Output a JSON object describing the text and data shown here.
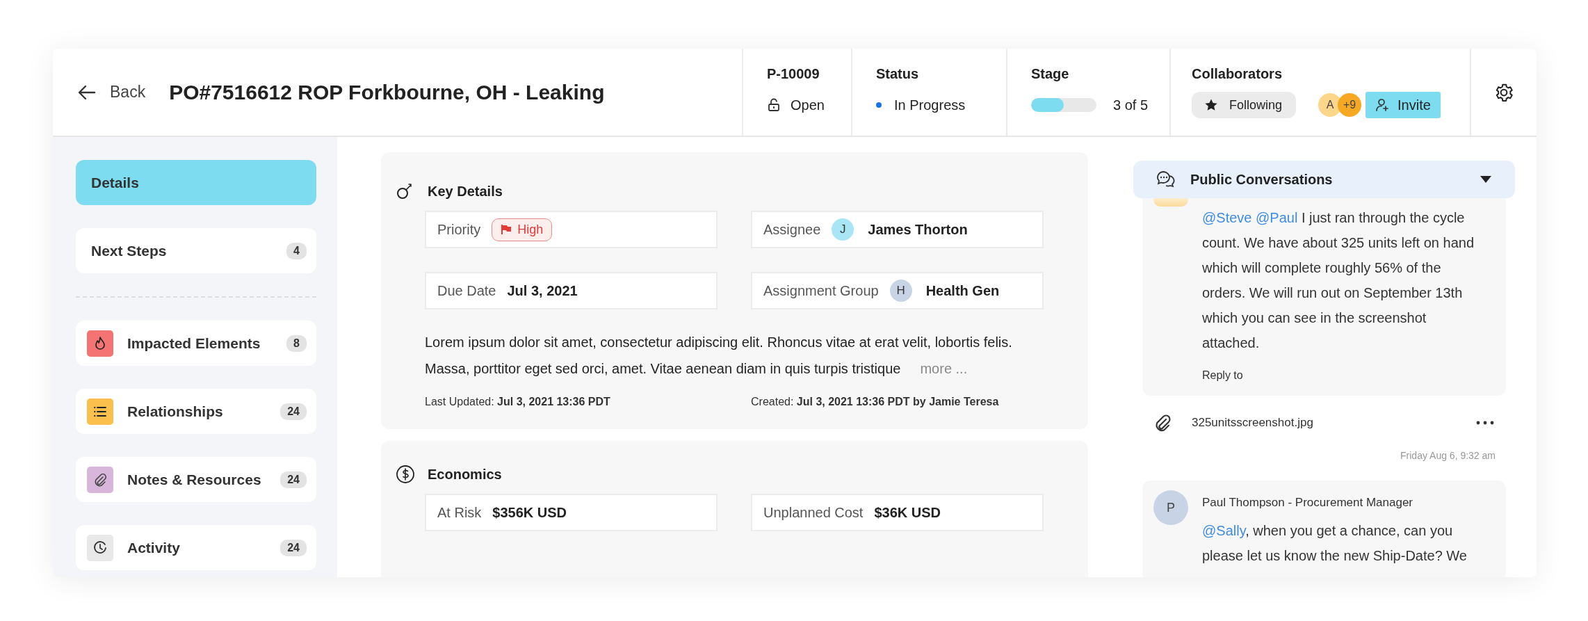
{
  "header": {
    "back": "Back",
    "title": "PO#7516612 ROP Forkbourne, OH - Leaking",
    "ticket": {
      "id": "P-10009",
      "state": "Open"
    },
    "status": {
      "label": "Status",
      "value": "In Progress"
    },
    "stage": {
      "label": "Stage",
      "level": 0.5,
      "reading": "3 of 5"
    },
    "collaborators": {
      "label": "Collaborators",
      "follow": "Following",
      "avatars": [
        {
          "text": "A",
          "color": "#fcd68a"
        },
        {
          "text": "+9",
          "color": "#f7a823"
        }
      ],
      "invite": "Invite"
    }
  },
  "sidebar": {
    "primary": [
      {
        "label": "Details",
        "selected": true
      },
      {
        "label": "Next Steps",
        "count": "4",
        "selected": false
      }
    ],
    "sections": [
      {
        "label": "Impacted Elements",
        "count": "8",
        "selected": false,
        "kind": "fire",
        "color": "#f47373"
      },
      {
        "label": "Relationships",
        "count": "24",
        "selected": false,
        "kind": "list",
        "color": "#fbbf4e"
      },
      {
        "label": "Notes & Resources",
        "count": "24",
        "selected": false,
        "kind": "clip",
        "color": "#d8b6dc"
      },
      {
        "label": "Activity",
        "count": "24",
        "selected": false,
        "kind": "clock",
        "color": "#e8e8e8"
      }
    ]
  },
  "key_details": {
    "title": "Key Details",
    "fields": [
      {
        "label": "Priority",
        "value": "High",
        "kind": "flag"
      },
      {
        "label": "Assignee",
        "value": "James Thorton",
        "kind": "person",
        "initial": "J",
        "color": "#a8e6f5"
      },
      {
        "label": "Due Date",
        "value": "Jul 3, 2021",
        "kind": "text"
      },
      {
        "label": "Assignment Group",
        "value": "Health Gen",
        "kind": "person",
        "initial": "H",
        "color": "#c8d4e6"
      }
    ],
    "description": "Lorem ipsum dolor sit amet, consectetur adipiscing elit. Rhoncus vitae at erat velit, lobortis felis. Massa, porttitor eget sed orci, amet. Vitae aenean diam in quis turpis tristique",
    "more": "more ...",
    "last_updated": "Last Updated: **Jul 3, 2021 13:36 PDT**",
    "created": "Created: **Jul 3, 2021 13:36 PDT by Jamie Teresa**"
  },
  "economics": {
    "title": "Economics",
    "fields": [
      {
        "label": "At Risk",
        "value": "$356K USD",
        "kind": "text"
      },
      {
        "label": "Unplanned Cost",
        "value": "$36K USD",
        "kind": "text"
      }
    ]
  },
  "conversations": {
    "title": "Public Conversations",
    "expanded": true,
    "messages": [
      {
        "mentions": [
          "@Steve",
          "@Paul"
        ],
        "text": " I just ran through the cycle count. We have about 325 units left on hand which will complete roughly 56% of the orders. We will run out on September 13th which you can see in the screenshot attached.",
        "reply": "Reply to",
        "attachment": "325unitsscreenshot.jpg",
        "time": "Friday Aug 6, 9:32 am"
      },
      {
        "initial": "P",
        "author": "Paul Thompson - Procurement Manager",
        "mentions": [
          "@Sally"
        ],
        "text": ", when you get a chance, can you please let us know the new Ship-Date? We"
      }
    ]
  }
}
